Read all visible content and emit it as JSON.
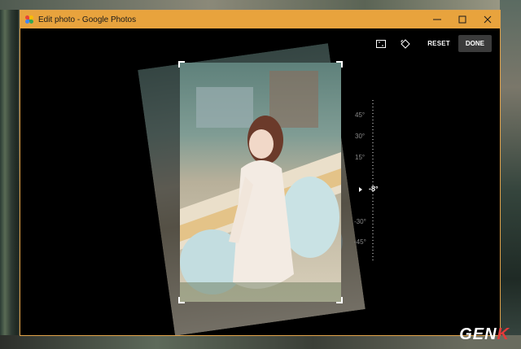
{
  "window": {
    "title": "Edit photo - Google Photos",
    "accent_color": "#e8a33d"
  },
  "window_controls": {
    "minimize_icon": "minimize-icon",
    "maximize_icon": "maximize-icon",
    "close_icon": "close-icon"
  },
  "toolbar": {
    "aspect_ratio_icon": "aspect-ratio-icon",
    "rotate_icon": "rotate-icon",
    "reset_label": "RESET",
    "done_label": "DONE"
  },
  "angle_dial": {
    "ticks": [
      "45°",
      "30°",
      "15°",
      "-30°",
      "-45°"
    ],
    "current_value": "-8°"
  },
  "watermark": {
    "text_main": "GEN",
    "text_accent": "K"
  }
}
